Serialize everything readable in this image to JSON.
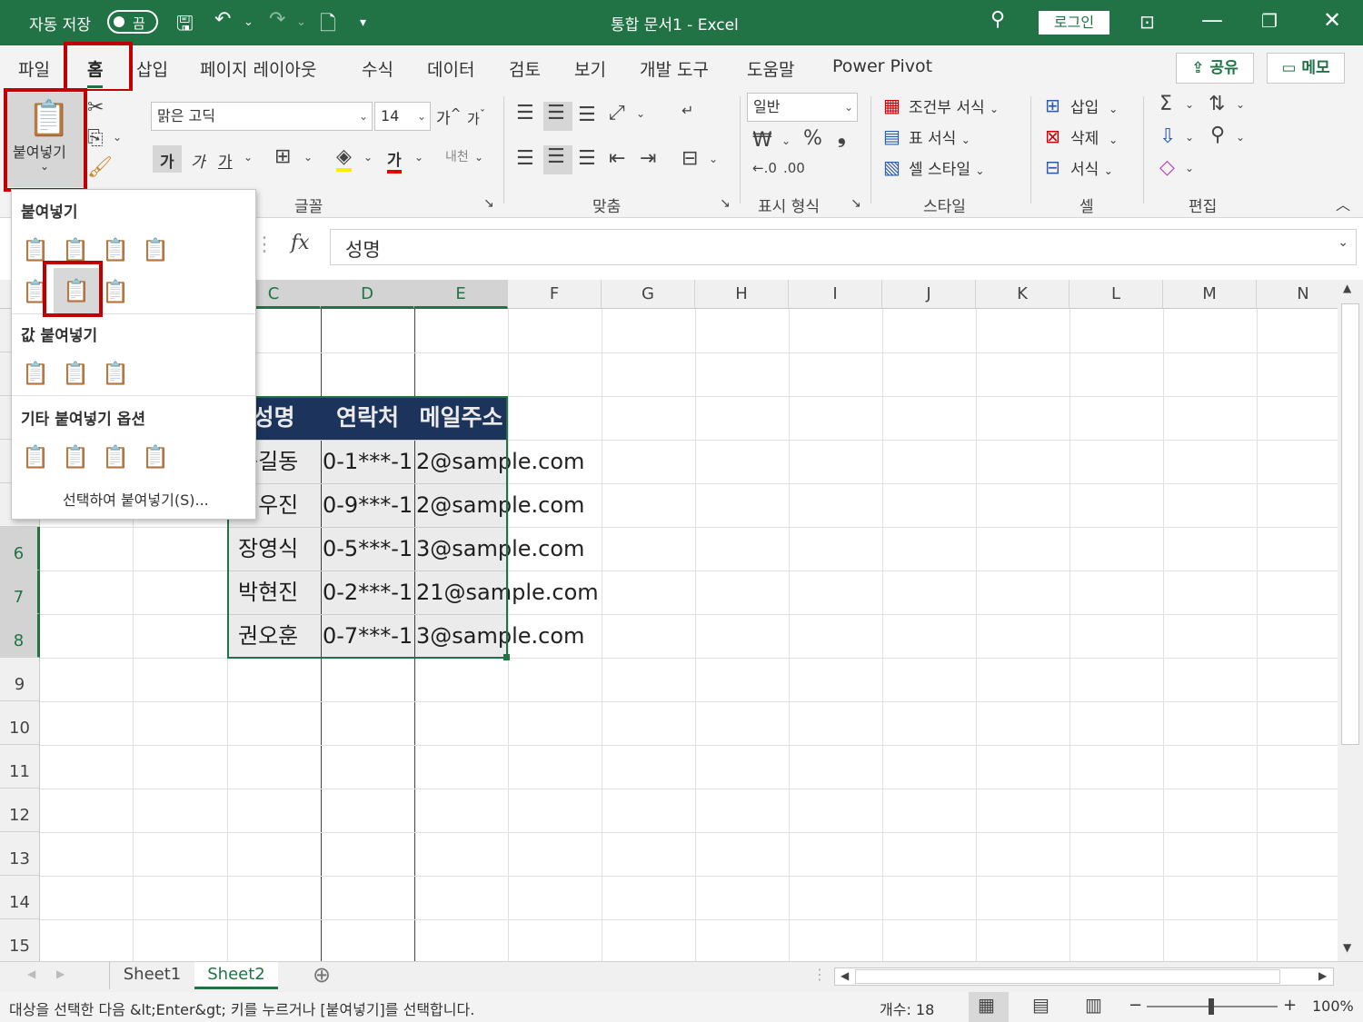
{
  "titlebar": {
    "autosave_label": "자동 저장",
    "autosave_state": "끔",
    "title": "통합 문서1 - Excel",
    "login": "로그인"
  },
  "tabs": [
    "파일",
    "홈",
    "삽입",
    "페이지 레이아웃",
    "수식",
    "데이터",
    "검토",
    "보기",
    "개발 도구",
    "도움말",
    "Power Pivot"
  ],
  "active_tab": "홈",
  "share_button": "공유",
  "memo_button": "메모",
  "ribbon": {
    "paste_label": "붙여넣기",
    "font_name": "맑은 고딕",
    "font_size": "14",
    "bold": "가",
    "italic": "가",
    "underline": "가",
    "font_color_glyph": "가",
    "grow_font": "가",
    "shrink_font": "가",
    "font_group": "글꼴",
    "align_group": "맞춤",
    "number_format": "일반",
    "number_group": "표시 형식",
    "cond_format": "조건부 서식",
    "table_format": "표 서식",
    "cell_style": "셀 스타일",
    "style_group": "스타일",
    "insert": "삽입",
    "delete": "삭제",
    "format": "서식",
    "cells_group": "셀",
    "edit_group": "편집"
  },
  "formula_bar": {
    "fx": "fx",
    "content": "성명"
  },
  "columns": [
    "C",
    "D",
    "E",
    "F",
    "G",
    "H",
    "I",
    "J",
    "K",
    "L",
    "M",
    "N"
  ],
  "rows": [
    "6",
    "7",
    "8",
    "9",
    "10",
    "11",
    "12",
    "13",
    "14",
    "15"
  ],
  "table": {
    "headers": [
      "성명",
      "연락처",
      "메일주소"
    ],
    "rows": [
      {
        "name": "동길동",
        "contact": "0-1***-1",
        "email": "2@sample.com"
      },
      {
        "name": "이우진",
        "contact": "0-9***-1",
        "email": "2@sample.com"
      },
      {
        "name": "장영식",
        "contact": "0-5***-1",
        "email": "3@sample.com"
      },
      {
        "name": "박현진",
        "contact": "0-2***-1",
        "email": "21@sample.com"
      },
      {
        "name": "권오훈",
        "contact": "0-7***-1",
        "email": "3@sample.com"
      }
    ]
  },
  "paste_menu": {
    "section1": "붙여넣기",
    "section2": "값 붙여넣기",
    "section3": "기타 붙여넣기 옵션",
    "special": "선택하여 붙여넣기(S)..."
  },
  "sheets": [
    "Sheet1",
    "Sheet2"
  ],
  "active_sheet": "Sheet2",
  "status": {
    "message": "대상을 선택한 다음 &lt;Enter&gt; 키를 누르거나 [붙여넣기]를 선택합니다.",
    "count": "개수: 18",
    "zoom": "100%"
  },
  "colors": {
    "excel_green": "#217346",
    "header_fill": "#1f3864",
    "highlight_red": "#c00000"
  }
}
